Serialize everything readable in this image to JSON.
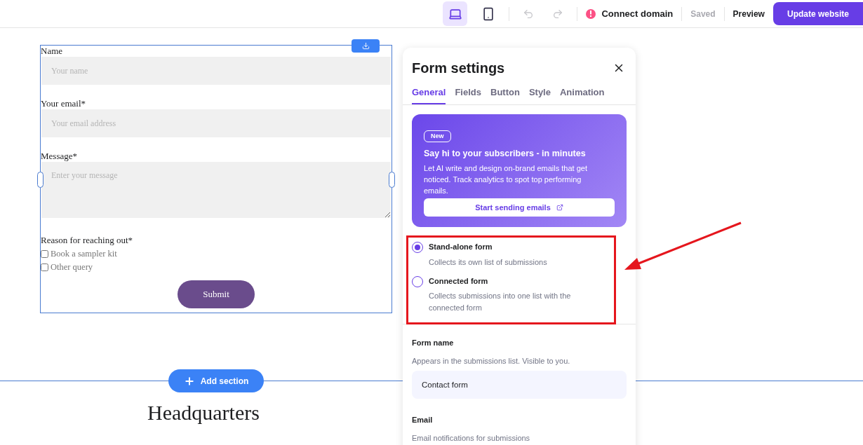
{
  "toolbar": {
    "devices": [
      {
        "kind": "desktop",
        "selected": true
      },
      {
        "kind": "mobile",
        "selected": false
      }
    ],
    "history": [
      {
        "kind": "undo",
        "disabled": true
      },
      {
        "kind": "redo",
        "disabled": true
      }
    ],
    "connect_domain": "Connect domain",
    "saved": {
      "label": "Saved",
      "disabled": true
    },
    "preview": "Preview",
    "update": "Update website"
  },
  "form": {
    "fields": [
      {
        "kind": "text",
        "label": "Name",
        "placeholder": "Your name"
      },
      {
        "kind": "text",
        "label": "Your email*",
        "placeholder": "Your email address"
      },
      {
        "kind": "textarea",
        "label": "Message*",
        "placeholder": "Enter your message"
      },
      {
        "kind": "checkboxes",
        "label": "Reason for reaching out*",
        "options": [
          {
            "label": "Book a sampler kit",
            "checked": false
          },
          {
            "label": "Other query",
            "checked": false
          }
        ]
      }
    ],
    "submit": "Submit"
  },
  "add_section": "Add section",
  "heading": "Headquarters",
  "panel": {
    "title": "Form settings",
    "tabs": [
      {
        "label": "General",
        "selected": true
      },
      {
        "label": "Fields",
        "selected": false
      },
      {
        "label": "Button",
        "selected": false
      },
      {
        "label": "Style",
        "selected": false
      },
      {
        "label": "Animation",
        "selected": false
      }
    ],
    "promo": {
      "badge": "New",
      "title": "Say hi to your subscribers - in minutes",
      "body": "Let AI write and design on-brand emails that get noticed. Track analytics to spot top performing emails.",
      "button": "Start sending emails"
    },
    "form_type": [
      {
        "label": "Stand-alone form",
        "description": "Collects its own list of submissions",
        "selected": true
      },
      {
        "label": "Connected form",
        "description": "Collects submissions into one list with the connected form",
        "selected": false
      }
    ],
    "form_name": {
      "label": "Form name",
      "hint": "Appears in the submissions list. Visible to you.",
      "value": "Contact form"
    },
    "email": {
      "label": "Email",
      "hint": "Email notifications for submissions"
    }
  }
}
